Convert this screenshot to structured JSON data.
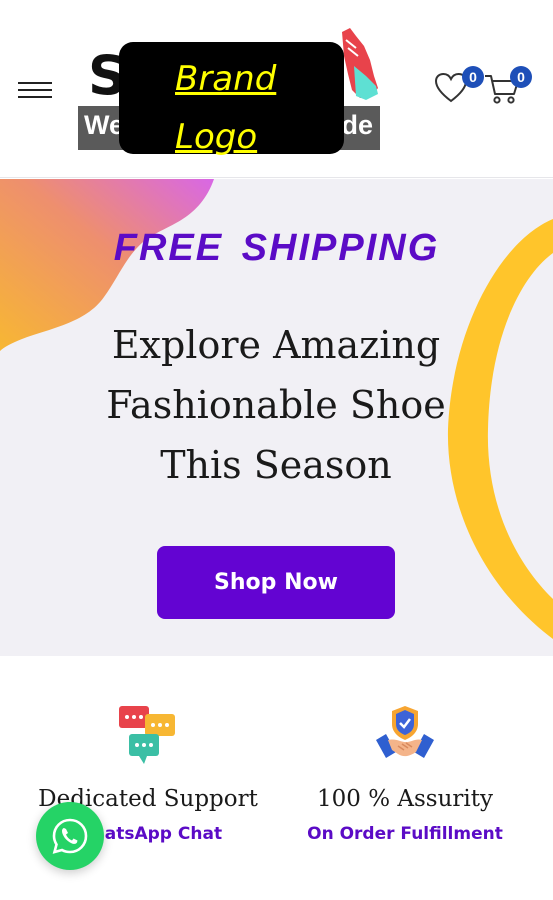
{
  "header": {
    "logo": {
      "overlay_line1": "Brand",
      "overlay_line2": "Logo",
      "brand_letter": "S",
      "tagline_left": "We",
      "tagline_right": "ide"
    },
    "wishlist_count": "0",
    "cart_count": "0",
    "icons": [
      "menu-icon",
      "heart-icon",
      "cart-icon"
    ]
  },
  "hero": {
    "kicker": "FREE  SHIPPING",
    "headline": "Explore Amazing Fashionable Shoe This Season",
    "cta_label": "Shop Now"
  },
  "features": [
    {
      "icon": "chat-bubbles-icon",
      "title": "Dedicated Support",
      "subtitle": "WhatsApp Chat"
    },
    {
      "icon": "handshake-shield-icon",
      "title": "100 % Assurity",
      "subtitle": "On Order Fulfillment"
    }
  ],
  "floating": {
    "icon": "whatsapp-icon"
  },
  "colors": {
    "accent": "#5b0bc6",
    "button": "#6304d2",
    "hero_bg": "#f1f0f5",
    "badge": "#1e4fb8",
    "whatsapp": "#25d366",
    "arc": "#ffc52b"
  }
}
